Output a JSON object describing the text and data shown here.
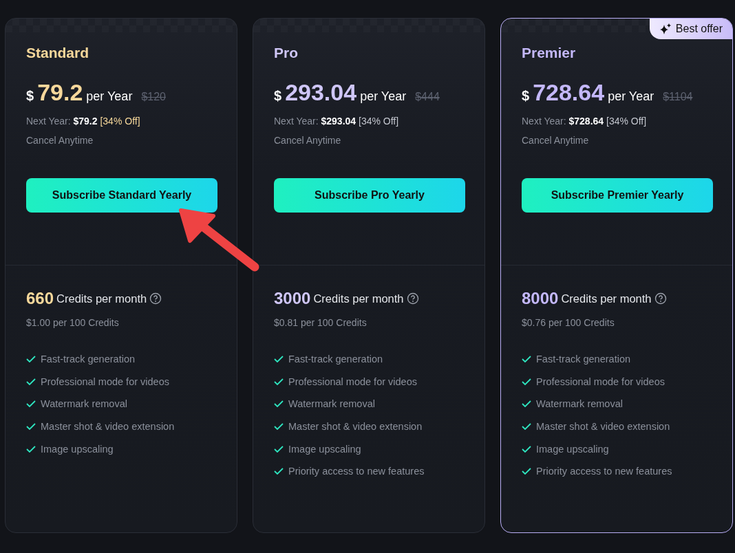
{
  "plans": [
    {
      "name": "Standard",
      "color": "#f7d89b",
      "highlighted": false,
      "currency": "$",
      "price": "79.2",
      "period": "per Year",
      "old_price": "$120",
      "next_year_label": "Next Year:",
      "next_year_price": "$79.2",
      "discount": "[34% Off]",
      "discount_highlighted": true,
      "cancel": "Cancel Anytime",
      "button": "Subscribe Standard Yearly",
      "credits": "660",
      "credits_label": "Credits per month",
      "credit_rate": "$1.00 per 100 Credits",
      "features": [
        "Fast-track generation",
        "Professional mode for videos",
        "Watermark removal",
        "Master shot & video extension",
        "Image upscaling"
      ]
    },
    {
      "name": "Pro",
      "color": "#cfc6f7",
      "highlighted": false,
      "currency": "$",
      "price": "293.04",
      "period": "per Year",
      "old_price": "$444",
      "next_year_label": "Next Year:",
      "next_year_price": "$293.04",
      "discount": "[34% Off]",
      "discount_highlighted": false,
      "cancel": "Cancel Anytime",
      "button": "Subscribe Pro Yearly",
      "credits": "3000",
      "credits_label": "Credits per month",
      "credit_rate": "$0.81 per 100 Credits",
      "features": [
        "Fast-track generation",
        "Professional mode for videos",
        "Watermark removal",
        "Master shot & video extension",
        "Image upscaling",
        "Priority access to new features"
      ]
    },
    {
      "name": "Premier",
      "color": "#c4b8fa",
      "highlighted": true,
      "badge": "Best offer",
      "currency": "$",
      "price": "728.64",
      "period": "per Year",
      "old_price": "$1104",
      "next_year_label": "Next Year:",
      "next_year_price": "$728.64",
      "discount": "[34% Off]",
      "discount_highlighted": false,
      "cancel": "Cancel Anytime",
      "button": "Subscribe Premier Yearly",
      "credits": "8000",
      "credits_label": "Credits per month",
      "credit_rate": "$0.76 per 100 Credits",
      "features": [
        "Fast-track generation",
        "Professional mode for videos",
        "Watermark removal",
        "Master shot & video extension",
        "Image upscaling",
        "Priority access to new features"
      ]
    }
  ]
}
